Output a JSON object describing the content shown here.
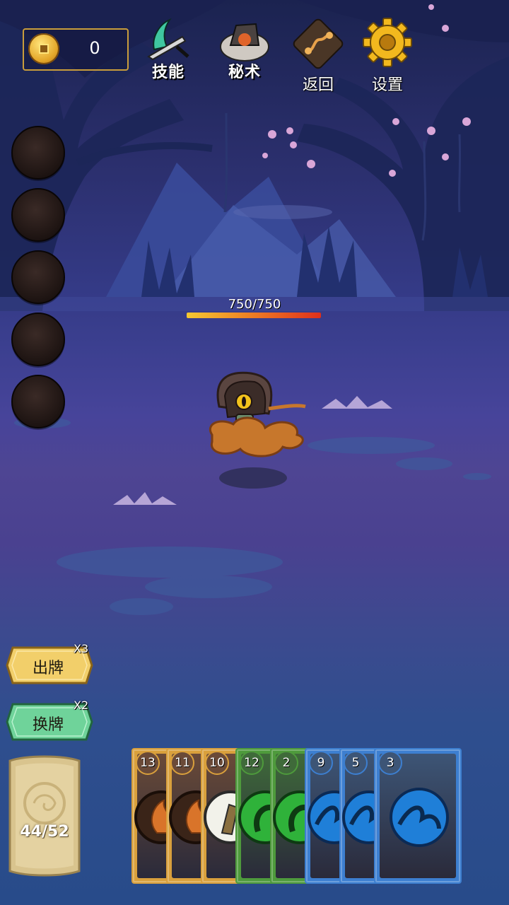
{
  "currency": {
    "icon": "coin-icon",
    "value": "0"
  },
  "top_buttons": [
    {
      "key": "skills",
      "label": "技能",
      "icon": "skill-blade-icon"
    },
    {
      "key": "secret",
      "label": "秘术",
      "icon": "secret-scroll-icon"
    },
    {
      "key": "back",
      "label": "返回",
      "icon": "route-back-icon"
    },
    {
      "key": "settings",
      "label": "设置",
      "icon": "gear-icon"
    }
  ],
  "relic_slots": 5,
  "enemy": {
    "hp_text": "750/750",
    "hp_current": 750,
    "hp_max": 750
  },
  "actions": {
    "play": {
      "label": "出牌",
      "multiplier": "X3",
      "color": "#e8c25a"
    },
    "swap": {
      "label": "换牌",
      "multiplier": "X2",
      "color": "#5fc48a"
    }
  },
  "deck": {
    "count_text": "44/52"
  },
  "hand": [
    {
      "number": "13",
      "element": "fire",
      "frame": "#d9a03c"
    },
    {
      "number": "11",
      "element": "fire",
      "frame": "#d9a03c"
    },
    {
      "number": "10",
      "element": "wind",
      "frame": "#d9a03c"
    },
    {
      "number": "12",
      "element": "wood",
      "frame": "#4e9a3c"
    },
    {
      "number": "2",
      "element": "wood",
      "frame": "#4e9a3c"
    },
    {
      "number": "9",
      "element": "water",
      "frame": "#3d7fd0"
    },
    {
      "number": "5",
      "element": "water",
      "frame": "#3d7fd0"
    },
    {
      "number": "3",
      "element": "water",
      "frame": "#3d7fd0"
    }
  ]
}
